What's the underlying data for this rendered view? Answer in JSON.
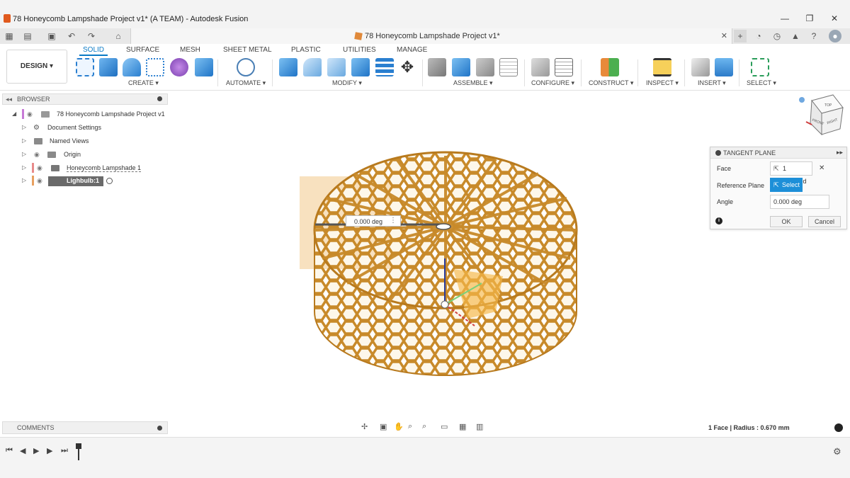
{
  "window": {
    "title": "78 Honeycomb Lampshade Project v1* (A TEAM) - Autodesk Fusion",
    "minimize": "—",
    "maximize": "❐",
    "close": "✕"
  },
  "tabbar": {
    "doc_tab": "78 Honeycomb Lampshade Project v1*",
    "close_tab": "✕",
    "new_tab": "+"
  },
  "workspace": {
    "button": "DESIGN ▾"
  },
  "toolbar_tabs": [
    "SOLID",
    "SURFACE",
    "MESH",
    "SHEET METAL",
    "PLASTIC",
    "UTILITIES",
    "MANAGE"
  ],
  "toolbar_groups": {
    "create": "CREATE ▾",
    "automate": "AUTOMATE ▾",
    "modify": "MODIFY ▾",
    "assemble": "ASSEMBLE ▾",
    "configure": "CONFIGURE ▾",
    "construct": "CONSTRUCT ▾",
    "inspect": "INSPECT ▾",
    "insert": "INSERT ▾",
    "select": "SELECT ▾"
  },
  "browser": {
    "title": "BROWSER",
    "items": [
      {
        "label": "78 Honeycomb Lampshade Project v1"
      },
      {
        "label": "Document Settings"
      },
      {
        "label": "Named Views"
      },
      {
        "label": "Origin"
      },
      {
        "label": "Honeycomb Lampshade 1"
      },
      {
        "label": "Lighbulb:1"
      }
    ]
  },
  "comments": {
    "title": "COMMENTS"
  },
  "dialog": {
    "title": "TANGENT PLANE",
    "face_label": "Face",
    "face_value": "1 selected",
    "ref_label": "Reference Plane",
    "ref_value": "Select",
    "angle_label": "Angle",
    "angle_value": "0.000 deg",
    "ok": "OK",
    "cancel": "Cancel"
  },
  "viewport": {
    "angle_input": "0.000 deg",
    "status": "1 Face | Radius : 0.670 mm",
    "viewcube": {
      "top": "TOP",
      "front": "FRONT",
      "right": "RIGHT"
    }
  },
  "colors": {
    "accent": "#0a7ac6",
    "lampshade": "#c88a2a",
    "plane": "#f3c98a"
  }
}
